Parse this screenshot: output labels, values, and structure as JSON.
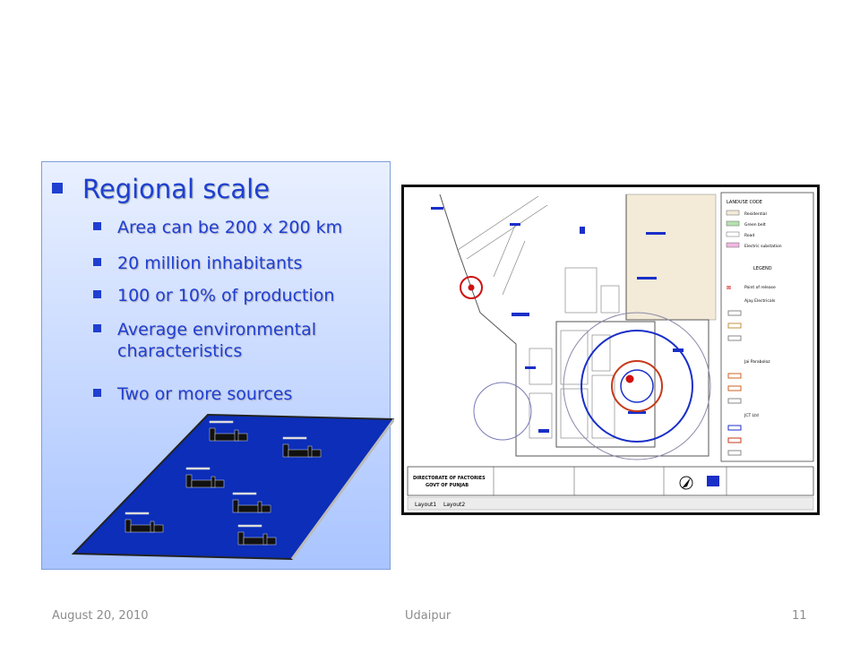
{
  "slide": {
    "main_bullet": "Regional scale",
    "sub_bullets": [
      "Area can be 200 x 200 km",
      "20 million inhabitants",
      "100 or 10% of production",
      "Average environmental characteristics",
      "Two or more sources"
    ]
  },
  "map": {
    "legend": {
      "landuse_title": "LANDUSE CODE",
      "landuse_items": [
        "Residential",
        "Green belt",
        "Road",
        "Electric substation"
      ],
      "legend_title": "LEGEND",
      "point_of_release": "Point of release",
      "companies": [
        "Ajay Electricals",
        "Jai Paraboloz",
        "JCT Ltd"
      ]
    },
    "title_block": [
      "DIRECTORATE OF FACTORIES",
      "GOVT OF PUNJAB"
    ],
    "tabs": [
      "Layout1",
      "Layout2"
    ]
  },
  "footer": {
    "date": "August 20, 2010",
    "place": "Udaipur",
    "page": "11"
  }
}
